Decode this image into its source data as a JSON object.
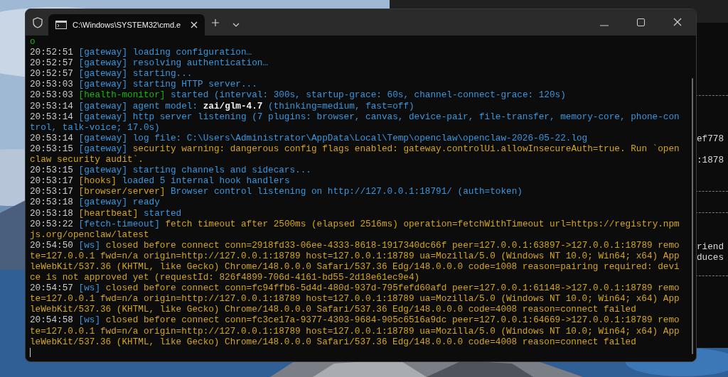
{
  "background_window": {
    "lines": [
      "ef778",
      ":1878",
      "riend",
      "duces"
    ]
  },
  "window": {
    "tab": {
      "title": "C:\\Windows\\SYSTEM32\\cmd.e",
      "selected": true
    }
  },
  "console": {
    "lines": [
      {
        "segments": [
          {
            "kind": "green",
            "text": "o"
          }
        ]
      },
      {
        "segments": [
          {
            "kind": "time",
            "text": "20:52:51"
          },
          {
            "kind": "blue",
            "text": "[gateway] loading configuration…"
          }
        ]
      },
      {
        "segments": [
          {
            "kind": "time",
            "text": "20:52:57"
          },
          {
            "kind": "blue",
            "text": "[gateway] resolving authentication…"
          }
        ]
      },
      {
        "segments": [
          {
            "kind": "time",
            "text": "20:52:57"
          },
          {
            "kind": "blue",
            "text": "[gateway] starting..."
          }
        ]
      },
      {
        "segments": [
          {
            "kind": "time",
            "text": "20:53:03"
          },
          {
            "kind": "blue",
            "text": "[gateway] starting HTTP server..."
          }
        ]
      },
      {
        "segments": [
          {
            "kind": "time",
            "text": "20:53:03"
          },
          {
            "kind": "green",
            "text": "[health-monitor]"
          },
          {
            "kind": "blue",
            "text": "started (interval: 300s, startup-grace: 60s, channel-connect-grace: 120s)"
          }
        ]
      },
      {
        "segments": [
          {
            "kind": "time",
            "text": "20:53:14"
          },
          {
            "kind": "blue",
            "text": "[gateway] agent model:"
          },
          {
            "kind": "white",
            "text": "zai/glm-4.7"
          },
          {
            "kind": "blue",
            "text": "(thinking=medium, fast=off)"
          }
        ]
      },
      {
        "segments": [
          {
            "kind": "time",
            "text": "20:53:14"
          },
          {
            "kind": "blue",
            "text": "[gateway] http server listening (7 plugins: browser, canvas, device-pair, file-transfer, memory-core, phone-con"
          }
        ]
      },
      {
        "segments": [
          {
            "kind": "blue",
            "text": "trol, talk-voice; 17.0s)"
          }
        ]
      },
      {
        "segments": [
          {
            "kind": "time",
            "text": "20:53:14"
          },
          {
            "kind": "blue",
            "text": "[gateway] log file: C:\\Users\\Administrator\\AppData\\Local\\Temp\\openclaw\\openclaw-2026-05-22.log"
          }
        ]
      },
      {
        "segments": [
          {
            "kind": "time",
            "text": "20:53:15"
          },
          {
            "kind": "blue",
            "text": "[gateway]"
          },
          {
            "kind": "yellow",
            "text": "security warning: dangerous config flags enabled: gateway.controlUi.allowInsecureAuth=true. Run `open"
          }
        ]
      },
      {
        "segments": [
          {
            "kind": "yellow",
            "text": "claw security audit`."
          }
        ]
      },
      {
        "segments": [
          {
            "kind": "time",
            "text": "20:53:15"
          },
          {
            "kind": "blue",
            "text": "[gateway] starting channels and sidecars..."
          }
        ]
      },
      {
        "segments": [
          {
            "kind": "time",
            "text": "20:53:17"
          },
          {
            "kind": "yellow",
            "text": "[hooks]"
          },
          {
            "kind": "blue",
            "text": "loaded 5 internal hook handlers"
          }
        ]
      },
      {
        "segments": [
          {
            "kind": "time",
            "text": "20:53:17"
          },
          {
            "kind": "yellow",
            "text": "[browser/server]"
          },
          {
            "kind": "blue",
            "text": "Browser control listening on http://127.0.0.1:18791/ (auth=token)"
          }
        ]
      },
      {
        "segments": [
          {
            "kind": "time",
            "text": "20:53:18"
          },
          {
            "kind": "blue",
            "text": "[gateway] ready"
          }
        ]
      },
      {
        "segments": [
          {
            "kind": "time",
            "text": "20:53:18"
          },
          {
            "kind": "yellow",
            "text": "[heartbeat]"
          },
          {
            "kind": "blue",
            "text": "started"
          }
        ]
      },
      {
        "segments": [
          {
            "kind": "time",
            "text": "20:53:22"
          },
          {
            "kind": "blue",
            "text": "[fetch-timeout]"
          },
          {
            "kind": "yellow",
            "text": "fetch timeout after 2500ms (elapsed 2516ms) operation=fetchWithTimeout url=https://registry.npm"
          }
        ]
      },
      {
        "segments": [
          {
            "kind": "yellow",
            "text": "js.org/openclaw/latest"
          }
        ]
      },
      {
        "segments": [
          {
            "kind": "time",
            "text": "20:54:50"
          },
          {
            "kind": "blue",
            "text": "[ws]"
          },
          {
            "kind": "yellow",
            "text": "closed before connect conn=2918fd33-06ee-4333-8618-1917340dc66f peer=127.0.0.1:63897->127.0.0.1:18789 remo"
          }
        ]
      },
      {
        "segments": [
          {
            "kind": "yellow",
            "text": "te=127.0.0.1 fwd=n/a origin=http://127.0.0.1:18789 host=127.0.0.1:18789 ua=Mozilla/5.0 (Windows NT 10.0; Win64; x64) App"
          }
        ]
      },
      {
        "segments": [
          {
            "kind": "yellow",
            "text": "leWebKit/537.36 (KHTML, like Gecko) Chrome/148.0.0.0 Safari/537.36 Edg/148.0.0.0 code=1008 reason=pairing required: devi"
          }
        ]
      },
      {
        "segments": [
          {
            "kind": "yellow",
            "text": "ce is not approved yet (requestId: 826f4899-706d-4161-bd55-2d18e61ec9e4)"
          }
        ]
      },
      {
        "segments": [
          {
            "kind": "time",
            "text": "20:54:57"
          },
          {
            "kind": "blue",
            "text": "[ws]"
          },
          {
            "kind": "yellow",
            "text": "closed before connect conn=fc94ffb6-5d4d-480d-937d-795fefd60afd peer=127.0.0.1:61148->127.0.0.1:18789 remo"
          }
        ]
      },
      {
        "segments": [
          {
            "kind": "yellow",
            "text": "te=127.0.0.1 fwd=n/a origin=http://127.0.0.1:18789 host=127.0.0.1:18789 ua=Mozilla/5.0 (Windows NT 10.0; Win64; x64) App"
          }
        ]
      },
      {
        "segments": [
          {
            "kind": "yellow",
            "text": "leWebKit/537.36 (KHTML, like Gecko) Chrome/148.0.0.0 Safari/537.36 Edg/148.0.0.0 code=4008 reason=connect failed"
          }
        ]
      },
      {
        "segments": [
          {
            "kind": "time",
            "text": "20:54:58"
          },
          {
            "kind": "blue",
            "text": "[ws]"
          },
          {
            "kind": "yellow",
            "text": "closed before connect conn=fc3ce17a-9377-4303-9684-905c6516a9dc peer=127.0.0.1:64669->127.0.0.1:18789 remo"
          }
        ]
      },
      {
        "segments": [
          {
            "kind": "yellow",
            "text": "te=127.0.0.1 fwd=n/a origin=http://127.0.0.1:18789 host=127.0.0.1:18789 ua=Mozilla/5.0 (Windows NT 10.0; Win64; x64) App"
          }
        ]
      },
      {
        "segments": [
          {
            "kind": "yellow",
            "text": "leWebKit/537.36 (KHTML, like Gecko) Chrome/148.0.0.0 Safari/537.36 Edg/148.0.0.0 code=4008 reason=connect failed"
          }
        ]
      }
    ]
  }
}
